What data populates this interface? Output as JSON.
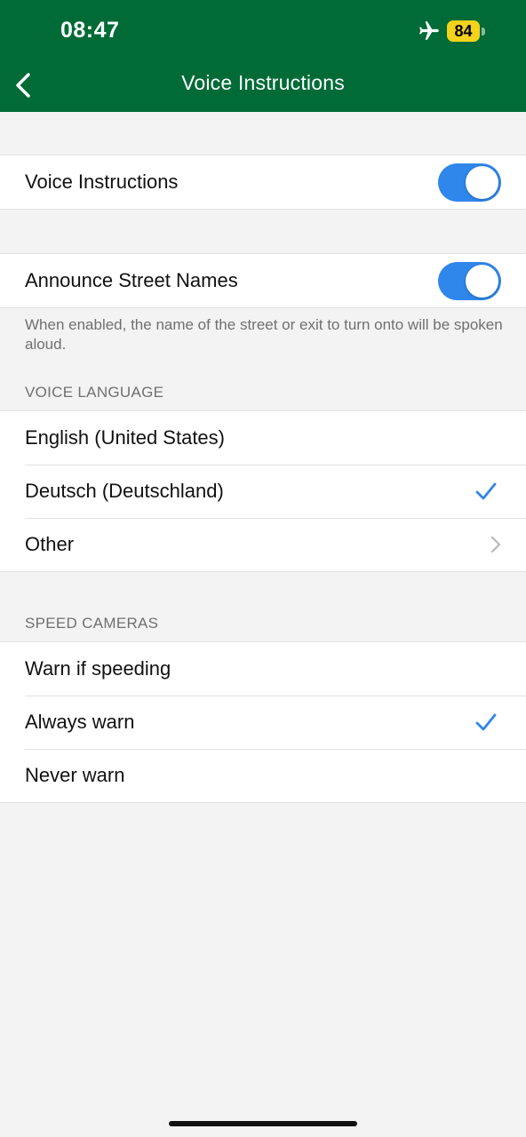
{
  "status_bar": {
    "time": "08:47",
    "battery": "84",
    "icons": [
      "airplane-icon",
      "battery-icon"
    ]
  },
  "nav": {
    "title": "Voice Instructions",
    "back_icon": "chevron-left-icon"
  },
  "voice_instructions": {
    "label": "Voice Instructions",
    "enabled": true
  },
  "announce_street_names": {
    "label": "Announce Street Names",
    "enabled": true,
    "footer": "When enabled, the name of the street or exit to turn onto will be spoken aloud."
  },
  "voice_language": {
    "header": "VOICE LANGUAGE",
    "items": [
      {
        "label": "English (United States)",
        "selected": false
      },
      {
        "label": "Deutsch (Deutschland)",
        "selected": true
      },
      {
        "label": "Other",
        "disclosure": true
      }
    ]
  },
  "speed_cameras": {
    "header": "SPEED CAMERAS",
    "items": [
      {
        "label": "Warn if speeding",
        "selected": false
      },
      {
        "label": "Always warn",
        "selected": true
      },
      {
        "label": "Never warn",
        "selected": false
      }
    ]
  },
  "colors": {
    "header_bg": "#006b36",
    "accent": "#2f86eb",
    "battery": "#f5d21b",
    "background": "#f3f3f3"
  }
}
